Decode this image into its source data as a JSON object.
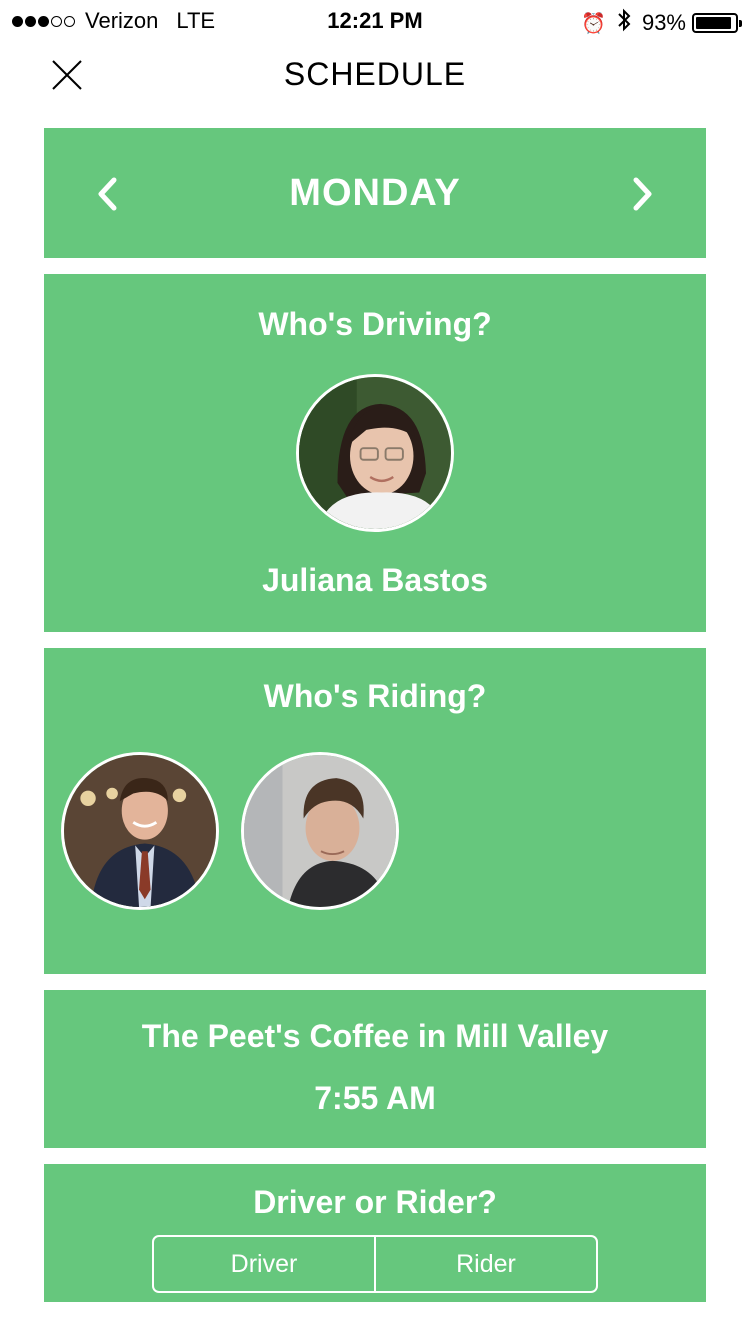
{
  "status_bar": {
    "carrier": "Verizon",
    "network": "LTE",
    "time": "12:21 PM",
    "battery_percent": "93%",
    "battery_level": 0.93,
    "signal_bars_filled": 3,
    "signal_bars_total": 5
  },
  "nav": {
    "title": "SCHEDULE",
    "close_icon": "close-icon"
  },
  "day_selector": {
    "day": "MONDAY",
    "prev_icon": "chevron-left-icon",
    "next_icon": "chevron-right-icon"
  },
  "driving": {
    "title": "Who's Driving?",
    "driver_name": "Juliana Bastos"
  },
  "riding": {
    "title": "Who's Riding?",
    "rider_count": 2
  },
  "location": {
    "name": "The Peet's Coffee in Mill Valley",
    "time": "7:55 AM"
  },
  "role": {
    "title": "Driver or Rider?",
    "options": [
      "Driver",
      "Rider"
    ]
  },
  "colors": {
    "accent_green": "#66c77d",
    "text_on_accent": "#ffffff"
  }
}
